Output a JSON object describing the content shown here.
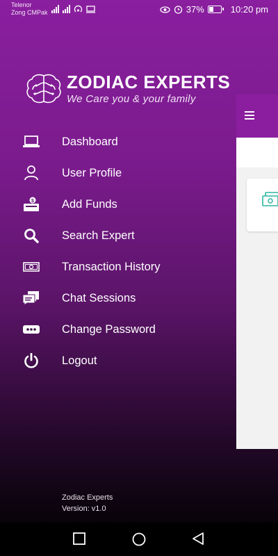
{
  "status_bar": {
    "carrier_1": "Telenor",
    "carrier_2": "Zong CMPak",
    "battery": "37%",
    "time": "10:20 pm"
  },
  "logo": {
    "title": "ZODIAC EXPERTS",
    "tagline": "We Care you & your family"
  },
  "menu": {
    "items": [
      {
        "label": "Dashboard",
        "icon": "laptop-icon"
      },
      {
        "label": "User Profile",
        "icon": "user-icon"
      },
      {
        "label": "Add Funds",
        "icon": "money-box-icon"
      },
      {
        "label": "Search Expert",
        "icon": "search-icon"
      },
      {
        "label": "Transaction History",
        "icon": "cash-icon"
      },
      {
        "label": "Chat Sessions",
        "icon": "chat-icon"
      },
      {
        "label": "Change Password",
        "icon": "password-icon"
      },
      {
        "label": "Logout",
        "icon": "power-icon"
      }
    ]
  },
  "footer": {
    "app_name": "Zodiac Experts",
    "version": "Version: v1.0"
  },
  "colors": {
    "accent": "#8b1e9e",
    "card_icon": "#2bb5a0"
  }
}
